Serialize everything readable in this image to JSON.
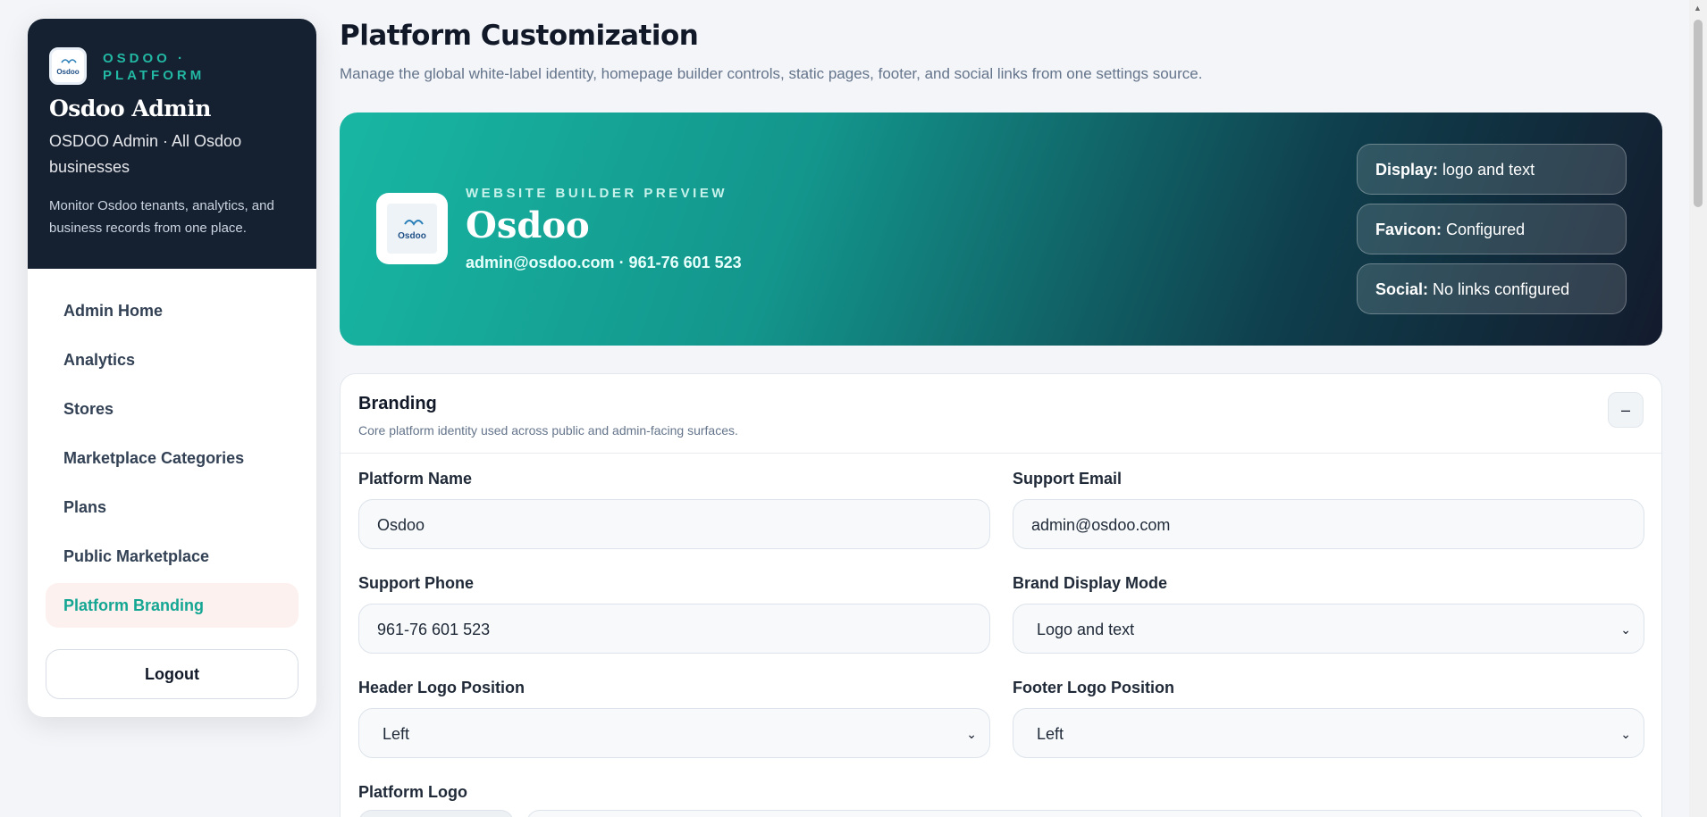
{
  "sidebar": {
    "eyebrow": "OSDOO · PLATFORM",
    "title": "Osdoo Admin",
    "subtitle": "OSDOO Admin · All Osdoo businesses",
    "description": "Monitor Osdoo tenants, analytics, and business records from one place.",
    "logo_text": "Osdoo",
    "nav": [
      {
        "label": "Admin Home"
      },
      {
        "label": "Analytics"
      },
      {
        "label": "Stores"
      },
      {
        "label": "Marketplace Categories"
      },
      {
        "label": "Plans"
      },
      {
        "label": "Public Marketplace"
      },
      {
        "label": "Platform Branding",
        "active": true
      }
    ],
    "logout_label": "Logout"
  },
  "header": {
    "title": "Platform Customization",
    "subtitle": "Manage the global white-label identity, homepage builder controls, static pages, footer, and social links from one settings source."
  },
  "hero": {
    "eyebrow": "WEBSITE BUILDER PREVIEW",
    "name": "Osdoo",
    "contact": "admin@osdoo.com · 961-76 601 523",
    "logo_text": "Osdoo",
    "chips": [
      {
        "key": "Display:",
        "value": "logo and text"
      },
      {
        "key": "Favicon:",
        "value": "Configured"
      },
      {
        "key": "Social:",
        "value": "No links configured"
      }
    ]
  },
  "branding": {
    "title": "Branding",
    "subtitle": "Core platform identity used across public and admin-facing surfaces.",
    "collapse_label": "–",
    "fields": {
      "platform_name": {
        "label": "Platform Name",
        "value": "Osdoo"
      },
      "support_email": {
        "label": "Support Email",
        "value": "admin@osdoo.com"
      },
      "support_phone": {
        "label": "Support Phone",
        "value": "961-76 601 523"
      },
      "brand_display_mode": {
        "label": "Brand Display Mode",
        "value": "Logo and text"
      },
      "header_logo_position": {
        "label": "Header Logo Position",
        "value": "Left"
      },
      "footer_logo_position": {
        "label": "Footer Logo Position",
        "value": "Left"
      },
      "platform_logo": {
        "label": "Platform Logo"
      }
    }
  },
  "colors": {
    "accent": "#14a693",
    "sidebar_dark": "#152031",
    "active_bg": "#fdf1ef"
  }
}
